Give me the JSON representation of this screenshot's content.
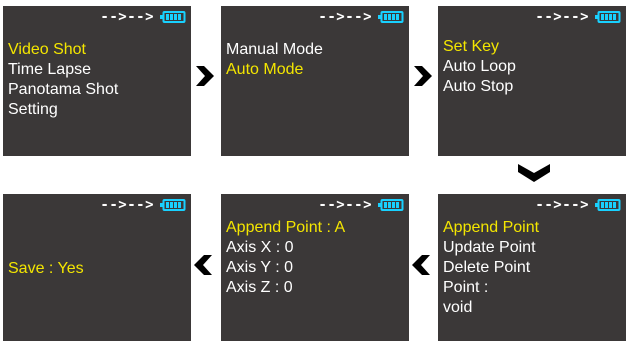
{
  "colors": {
    "screen_bg": "#3b3838",
    "text": "#ffffff",
    "selected": "#f4e600",
    "battery": "#18d1ff",
    "arrow": "#000000"
  },
  "icons": {
    "battery": "battery-icon",
    "next": "chevron-right-icon",
    "down": "chevron-down-icon",
    "back": "chevron-left-icon"
  },
  "status": {
    "mode_indicator": "-->-->"
  },
  "screens": [
    {
      "items": [
        {
          "label": "Video Shot",
          "selected": true
        },
        {
          "label": "Time Lapse",
          "selected": false
        },
        {
          "label": "Panotama Shot",
          "selected": false
        },
        {
          "label": "Setting",
          "selected": false
        }
      ]
    },
    {
      "items": [
        {
          "label": "Manual Mode",
          "selected": false
        },
        {
          "label": "Auto Mode",
          "selected": true
        }
      ]
    },
    {
      "items": [
        {
          "label": "Set Key",
          "selected": true
        },
        {
          "label": "Auto Loop",
          "selected": false
        },
        {
          "label": "Auto Stop",
          "selected": false
        }
      ]
    },
    {
      "items": [
        {
          "label": "Save : Yes",
          "selected": true
        }
      ]
    },
    {
      "items": [
        {
          "label": "Append Point : A",
          "selected": true
        },
        {
          "label": "Axis X : 0",
          "selected": false
        },
        {
          "label": "Axis Y : 0",
          "selected": false
        },
        {
          "label": "Axis Z : 0",
          "selected": false
        }
      ]
    },
    {
      "items": [
        {
          "label": "Append Point",
          "selected": true
        },
        {
          "label": "Update Point",
          "selected": false
        },
        {
          "label": "Delete Point",
          "selected": false
        },
        {
          "label": "Point :",
          "selected": false
        },
        {
          "label": "void",
          "selected": false
        }
      ]
    }
  ]
}
